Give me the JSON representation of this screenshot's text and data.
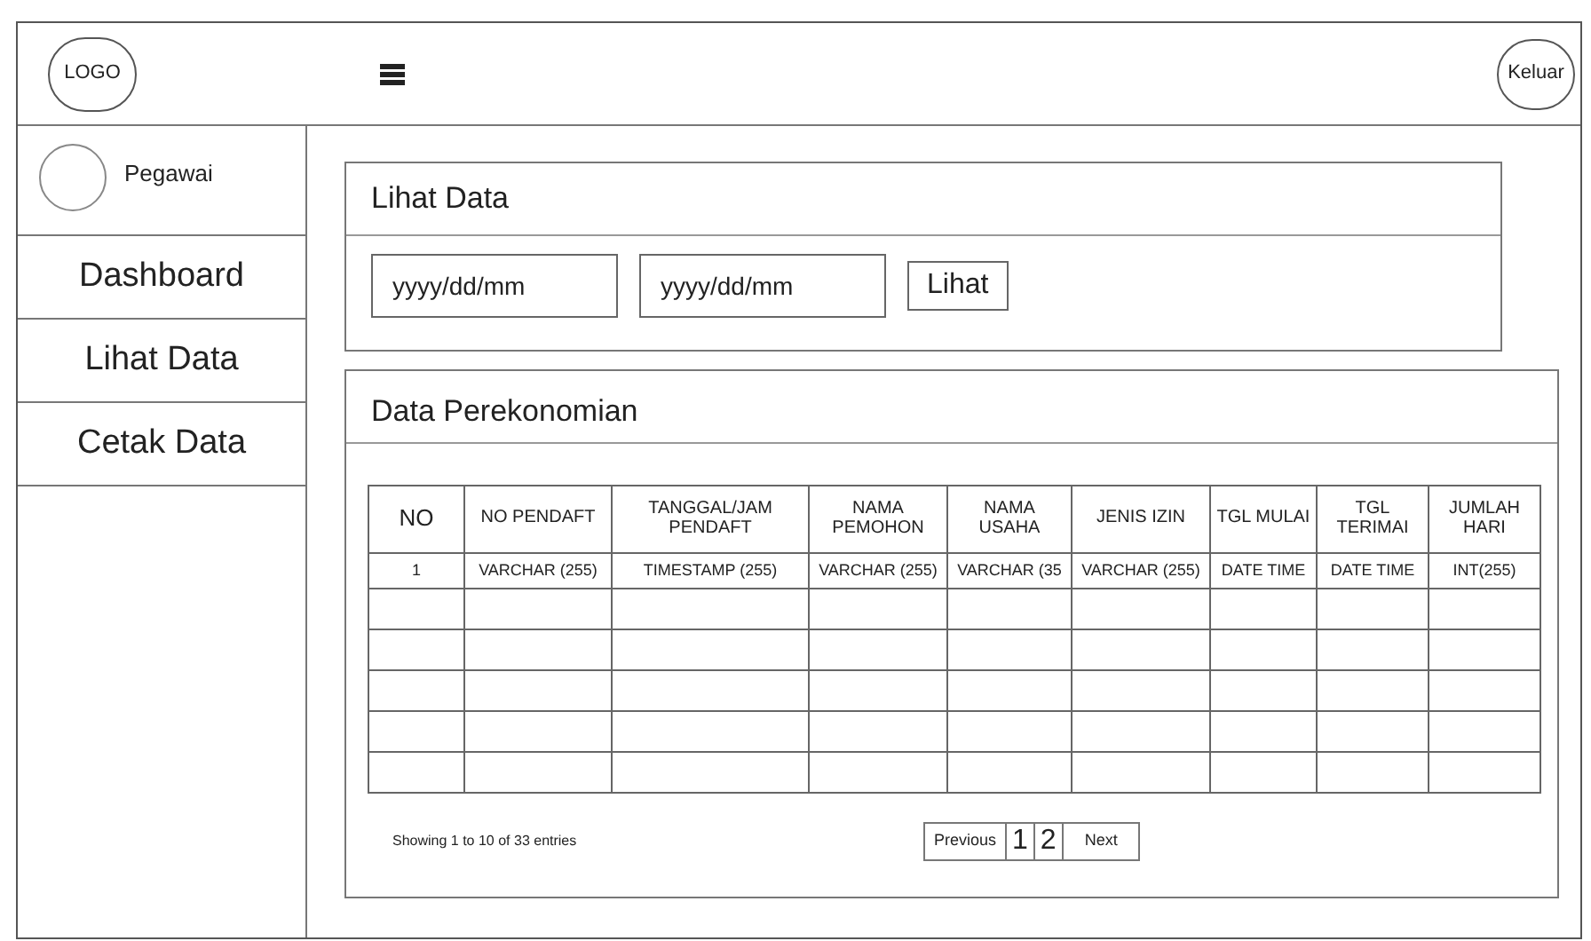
{
  "header": {
    "logo": "LOGO",
    "logout": "Keluar"
  },
  "sidebar": {
    "user": "Pegawai",
    "items": [
      {
        "label": "Dashboard"
      },
      {
        "label": "Lihat Data"
      },
      {
        "label": "Cetak Data"
      }
    ]
  },
  "filter_panel": {
    "title": "Lihat Data",
    "fields": [
      {
        "value": "yyyy/dd/mm"
      },
      {
        "value": "yyyy/dd/mm"
      }
    ],
    "button": "Lihat"
  },
  "data_panel": {
    "title": "Data Perekonomian",
    "table": {
      "columns": [
        "NO",
        "NO PENDAFT",
        "TANGGAL/JAM PENDAFT",
        "NAMA PEMOHON",
        "NAMA USAHA",
        "JENIS IZIN",
        "TGL MULAI",
        "TGL TERIMAI",
        "JUMLAH HARI"
      ],
      "rows": [
        [
          "1",
          "VARCHAR (255)",
          "TIMESTAMP (255)",
          "VARCHAR (255)",
          "VARCHAR (35",
          "VARCHAR (255)",
          "DATE TIME",
          "DATE TIME",
          "INT(255)"
        ]
      ]
    },
    "info": "Showing 1 to 10 of 33 entries",
    "pagination": [
      {
        "label": "Previous",
        "kind": "nav"
      },
      {
        "label": "1",
        "kind": "page"
      },
      {
        "label": "2",
        "kind": "page"
      },
      {
        "label": "Next",
        "kind": "nav"
      }
    ]
  }
}
